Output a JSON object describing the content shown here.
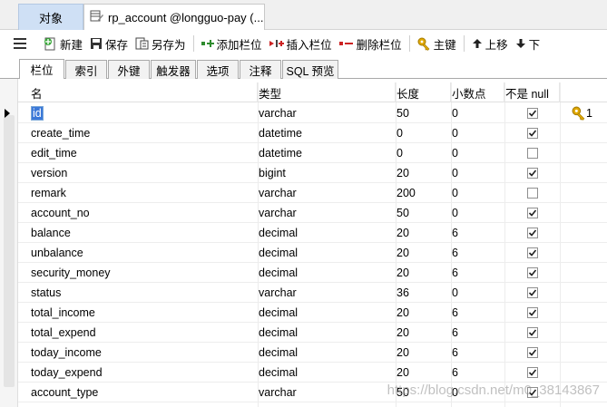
{
  "top_tabs": {
    "objects_label": "对象",
    "table_label": "rp_account @longguo-pay (..."
  },
  "toolbar": {
    "new_label": "新建",
    "save_label": "保存",
    "save_as_label": "另存为",
    "add_column_label": "添加栏位",
    "insert_column_label": "插入栏位",
    "delete_column_label": "删除栏位",
    "primary_key_label": "主键",
    "move_up_label": "上移",
    "move_down_label": "下"
  },
  "sub_tabs": [
    "栏位",
    "索引",
    "外键",
    "触发器",
    "选项",
    "注释",
    "SQL 预览"
  ],
  "columns": {
    "name": "名",
    "type": "类型",
    "length": "长度",
    "decimals": "小数点",
    "not_null": "不是 null"
  },
  "rows": [
    {
      "name": "id",
      "type": "varchar",
      "length": "50",
      "decimals": "0",
      "not_null": true,
      "key": "1"
    },
    {
      "name": "create_time",
      "type": "datetime",
      "length": "0",
      "decimals": "0",
      "not_null": true,
      "key": ""
    },
    {
      "name": "edit_time",
      "type": "datetime",
      "length": "0",
      "decimals": "0",
      "not_null": false,
      "key": ""
    },
    {
      "name": "version",
      "type": "bigint",
      "length": "20",
      "decimals": "0",
      "not_null": true,
      "key": ""
    },
    {
      "name": "remark",
      "type": "varchar",
      "length": "200",
      "decimals": "0",
      "not_null": false,
      "key": ""
    },
    {
      "name": "account_no",
      "type": "varchar",
      "length": "50",
      "decimals": "0",
      "not_null": true,
      "key": ""
    },
    {
      "name": "balance",
      "type": "decimal",
      "length": "20",
      "decimals": "6",
      "not_null": true,
      "key": ""
    },
    {
      "name": "unbalance",
      "type": "decimal",
      "length": "20",
      "decimals": "6",
      "not_null": true,
      "key": ""
    },
    {
      "name": "security_money",
      "type": "decimal",
      "length": "20",
      "decimals": "6",
      "not_null": true,
      "key": ""
    },
    {
      "name": "status",
      "type": "varchar",
      "length": "36",
      "decimals": "0",
      "not_null": true,
      "key": ""
    },
    {
      "name": "total_income",
      "type": "decimal",
      "length": "20",
      "decimals": "6",
      "not_null": true,
      "key": ""
    },
    {
      "name": "total_expend",
      "type": "decimal",
      "length": "20",
      "decimals": "6",
      "not_null": true,
      "key": ""
    },
    {
      "name": "today_income",
      "type": "decimal",
      "length": "20",
      "decimals": "6",
      "not_null": true,
      "key": ""
    },
    {
      "name": "today_expend",
      "type": "decimal",
      "length": "20",
      "decimals": "6",
      "not_null": true,
      "key": ""
    },
    {
      "name": "account_type",
      "type": "varchar",
      "length": "50",
      "decimals": "0",
      "not_null": true,
      "key": ""
    }
  ],
  "watermark": "https://blog.csdn.net/m0_38143867",
  "colors": {
    "objects_tab_bg": "#cfe0f5",
    "selected_cell_bg": "#3b78d8",
    "key_gold": "#d4a017"
  }
}
